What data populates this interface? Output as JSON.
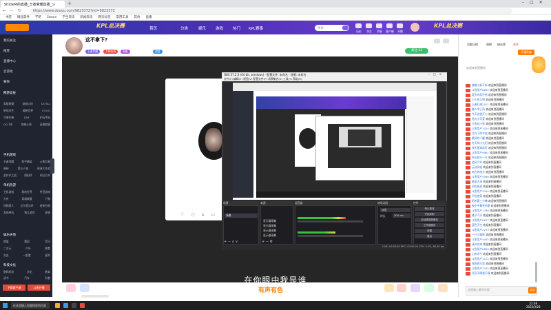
{
  "browser": {
    "tab_title": "ShiDeM的直播_王者荣耀直播_斗",
    "url": "https://www.douyu.com/9823372?rid=9823372",
    "bookmarks": [
      "书签",
      "精品软件",
      "学吧",
      "Steam",
      "学生资讯",
      "新闻资讯",
      "网页标签",
      "常用工具",
      "其他",
      "直播"
    ]
  },
  "site_header": {
    "nav": [
      "首页",
      "分类",
      "娱乐",
      "游戏",
      "热门",
      "KPL赛事"
    ],
    "search_placeholder": "搜索",
    "icons": [
      {
        "name": "history-icon",
        "label": "历史"
      },
      {
        "name": "follow-icon",
        "label": "关注"
      },
      {
        "name": "message-icon",
        "label": "消息"
      },
      {
        "name": "client-icon",
        "label": "客户端"
      },
      {
        "name": "upload-icon",
        "label": "开播"
      }
    ],
    "banner_text": "KPL总决赛"
  },
  "sidebar": {
    "items": [
      "我的关注",
      "推荐",
      "直播中心",
      "云游戏",
      "赛事"
    ],
    "sections": [
      {
        "title": "网游竞技",
        "rows": [
          [
            "英雄联盟",
            "穿越火线",
            "DOTA2"
          ],
          [
            "绝地求生",
            "魔兽世界",
            "CS:GO"
          ],
          [
            "守望先锋",
            "DNF",
            "炉石传说"
          ],
          [
            "QQ飞车",
            "穿越火线",
            "英雄联盟"
          ]
        ]
      },
      {
        "title": "手机游戏",
        "rows": [
          [
            "王者荣耀",
            "和平精英",
            "火影忍者"
          ],
          [
            "原神",
            "第五人格",
            "球球大作战"
          ],
          [
            "金铲铲之战",
            "阴阳师",
            "明日方舟"
          ]
        ]
      },
      {
        "title": "单机热游",
        "rows": [
          [
            "主机游戏",
            "我的世界",
            "怀旧游戏"
          ],
          [
            "方舟",
            "英雄联盟",
            "只狼"
          ],
          [
            "怪物猎人",
            "艾尔登法环",
            "使命召唤"
          ],
          [
            "其他单机",
            "独立游戏",
            "拳皇"
          ]
        ]
      },
      {
        "title": "娱乐天地",
        "rows": [
          [
            "颜值",
            "舞蹈",
            "音乐"
          ],
          [
            "二次元",
            "户外",
            "美食"
          ],
          [
            "交友",
            "一起看",
            "星秀"
          ]
        ]
      },
      {
        "title": "科技文化",
        "rows": [
          [
            "数码科技",
            "文化",
            "教育"
          ],
          [
            "读书",
            "汽车",
            "科普"
          ]
        ]
      }
    ],
    "bottom_buttons": [
      "下载客户端",
      "斗鱼开播"
    ]
  },
  "room": {
    "title": "这不拿下?",
    "tags": [
      "王者荣耀",
      "大神在线",
      "高能",
      "超管"
    ],
    "follow_label": "关注",
    "follow_count": "43"
  },
  "obs": {
    "title": "OBS 27.2.3 (64-bit, windows) - 配置文件: 未命名 - 场景: 未命名",
    "menu": [
      "文件(F)",
      "编辑(E)",
      "视图(V)",
      "配置文件(P)",
      "场景集合(S)",
      "工具(T)",
      "帮助(H)"
    ],
    "docks": [
      "场景",
      "来源",
      "混音器",
      "转场动画",
      "控件"
    ],
    "scene": "场景",
    "sources": [
      "显示器采集",
      "显示器采集",
      "显示器采集",
      "显示器采集"
    ],
    "controls": [
      "停止推流",
      "开始录制",
      "启动虚拟摄像机",
      "工作室模式",
      "设置",
      "退出"
    ],
    "transition": "淡出",
    "duration_label": "时长",
    "duration_value": "300 ms",
    "status": "LIVE: 00:00:00   REC: 00:00:00   CPU: 5.4%, 60.00 fps"
  },
  "video": {
    "subtitle": "在你眼中我是谁",
    "watermark": "有声有色"
  },
  "right_panel": {
    "rank_tabs": [
      "贡献日榜",
      "周榜",
      "粉丝榜",
      "贵宾"
    ],
    "rank_button": "开通贵族",
    "notice": "欢迎来到直播间",
    "chat": [
      {
        "nick": "蜡笔小新不新",
        "msg": "欢迎来到直播间"
      },
      {
        "nick": "斗鱼用户8832",
        "msg": "欢迎来到直播间"
      },
      {
        "nick": "夏天的风不热",
        "msg": "欢迎来到直播间"
      },
      {
        "nick": "小小鱼儿啊",
        "msg": "欢迎来到直播间"
      },
      {
        "nick": "王者归来2021",
        "msg": "欢迎来到直播间"
      },
      {
        "nick": "路人甲乙丙",
        "msg": "欢迎来到直播间"
      },
      {
        "nick": "今天也很开心",
        "msg": "欢迎来到直播间"
      },
      {
        "nick": "鱼丸小可爱",
        "msg": "欢迎来到直播间"
      },
      {
        "nick": "大鱼吃小鱼",
        "msg": "欢迎来到直播间"
      },
      {
        "nick": "斗鱼用户1024",
        "msg": "欢迎来到直播间"
      },
      {
        "nick": "月光下的守候",
        "msg": "欢迎来到直播间"
      },
      {
        "nick": "晚风吹人醒",
        "msg": "欢迎来到直播间"
      },
      {
        "nick": "冬天的小太阳",
        "msg": "欢迎来到直播间"
      },
      {
        "nick": "快乐星球居民",
        "msg": "欢迎来到直播间"
      },
      {
        "nick": "斗鱼用户9981",
        "msg": "欢迎来到直播间"
      },
      {
        "nick": "吃瓜群众一号",
        "msg": "欢迎来到直播间"
      },
      {
        "nick": "追风少年",
        "msg": "欢迎来到直播间"
      },
      {
        "nick": "云淡风轻",
        "msg": "欢迎来到直播间"
      },
      {
        "nick": "南方的南方",
        "msg": "欢迎来到直播间"
      },
      {
        "nick": "斗鱼用户5566",
        "msg": "欢迎来到直播间"
      },
      {
        "nick": "星辰大海",
        "msg": "欢迎来到直播间"
      },
      {
        "nick": "风吹麦浪",
        "msg": "欢迎来到直播间"
      },
      {
        "nick": "斗鱼用户3344",
        "msg": "欢迎来到直播间"
      },
      {
        "nick": "不吃香菜",
        "msg": "欢迎来到直播间"
      },
      {
        "nick": "奶茶要三分糖",
        "msg": "欢迎来到直播间"
      },
      {
        "nick": "夜空中最亮的星",
        "msg": "欢迎来到直播间"
      },
      {
        "nick": "斗鱼用户7788",
        "msg": "欢迎来到直播间"
      },
      {
        "nick": "橘子汽水",
        "msg": "欢迎来到直播间"
      },
      {
        "nick": "斗鱼用户6677",
        "msg": "欢迎来到直播间"
      },
      {
        "nick": "蓝色天空",
        "msg": "欢迎来到直播间"
      },
      {
        "nick": "斗鱼用户2233",
        "msg": "欢迎来到直播间"
      },
      {
        "nick": "一只小猫咪",
        "msg": "欢迎来到直播间"
      },
      {
        "nick": "斗鱼用户4455",
        "msg": "欢迎来到直播间"
      },
      {
        "nick": "清风徐来",
        "msg": "欢迎来到直播间"
      },
      {
        "nick": "斗鱼用户8899",
        "msg": "欢迎来到直播间"
      },
      {
        "nick": "山有木兮",
        "msg": "欢迎来到直播间"
      },
      {
        "nick": "斗鱼用户1122",
        "msg": "欢迎来到直播间"
      },
      {
        "nick": "海底两万里",
        "msg": "欢迎来到直播间"
      },
      {
        "nick": "斗鱼用户3355",
        "msg": "欢迎来到直播间"
      },
      {
        "nick": "月亮不睡我不睡",
        "msg": "欢迎来到直播间"
      }
    ],
    "input_placeholder": "这里输入聊天内容",
    "send_label": "发送"
  },
  "taskbar": {
    "search_placeholder": "在这里输入你要搜索的内容",
    "time": "22:08",
    "date": "2022/3/28"
  },
  "colors": {
    "header_purple": "#4b2fb5",
    "accent_orange": "#ff7a00",
    "follow_green": "#3cbf6e",
    "sidebar_dark": "#1f2430"
  }
}
